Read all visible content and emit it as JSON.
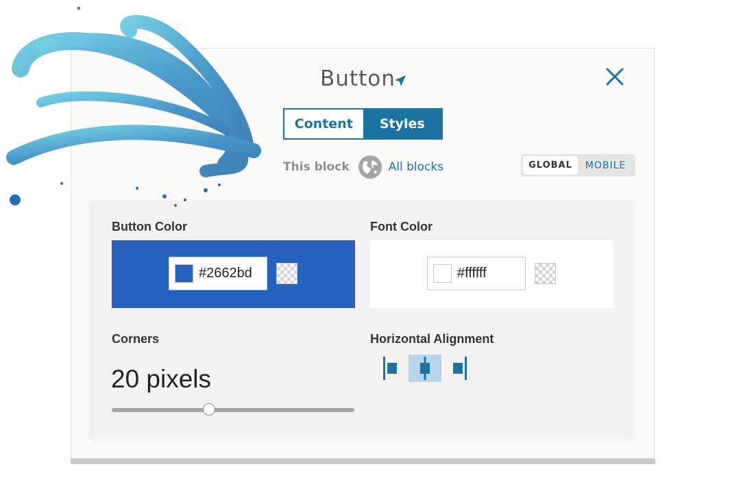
{
  "colors": {
    "accent": "#1b73a0",
    "button_color": "#2662bd",
    "font_color": "#ffffff"
  },
  "header": {
    "title": "Button",
    "title_icon": "navigation-arrow-icon",
    "close_icon": "close-icon"
  },
  "tabs": [
    {
      "label": "Content",
      "active": false
    },
    {
      "label": "Styles",
      "active": true
    }
  ],
  "scope": {
    "this_block": "This block",
    "globe_icon": "globe-icon",
    "all_blocks": "All blocks"
  },
  "device_toggle": {
    "global": "GLOBAL",
    "mobile": "MOBILE",
    "selected": "GLOBAL"
  },
  "button_color": {
    "label": "Button Color",
    "value": "#2662bd"
  },
  "font_color": {
    "label": "Font Color",
    "value": "#ffffff"
  },
  "corners": {
    "label": "Corners",
    "value_text": "20 pixels",
    "slider_fraction": 0.4
  },
  "alignment": {
    "label": "Horizontal Alignment",
    "options": [
      "align-left-icon",
      "align-center-icon",
      "align-right-icon"
    ],
    "selected": "center"
  }
}
